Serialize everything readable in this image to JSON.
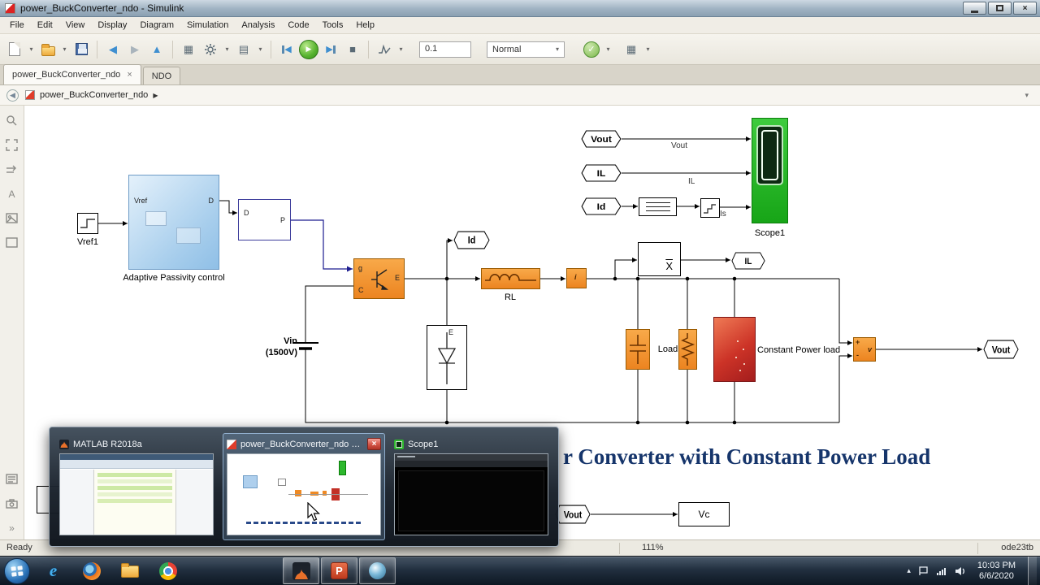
{
  "glyphs": {
    "caret_down": "▾",
    "crumb_arrow": "▶",
    "close": "×",
    "chevrons": "»",
    "tray_caret": "▴",
    "run_arrow": "▶",
    "back_arrow": "◀",
    "forward_arrow": "▶",
    "up_arrow": "▲",
    "stop_square": "■",
    "check": "✓",
    "grid": "▦",
    "list": "▤",
    "letter_a": "A",
    "ie_e": "e",
    "pp_p": "P"
  },
  "titlebar": {
    "title": "power_BuckConverter_ndo - Simulink"
  },
  "menubar": {
    "items": [
      "File",
      "Edit",
      "View",
      "Display",
      "Diagram",
      "Simulation",
      "Analysis",
      "Code",
      "Tools",
      "Help"
    ]
  },
  "toolbar": {
    "stop_time": "0.1",
    "mode": "Normal"
  },
  "tabbar": {
    "tabs": [
      {
        "label": "power_BuckConverter_ndo"
      },
      {
        "label": "NDO"
      }
    ]
  },
  "breadcrumb": {
    "path": "power_BuckConverter_ndo"
  },
  "canvas": {
    "annotation": "r Converter with Constant Power Load",
    "blocks": {
      "vref1": "Vref1",
      "apc_label": "Adaptive Passivity control",
      "apc_in": "Vref",
      "apc_out": "D",
      "ctrl_in": "D",
      "ctrl_out": "P",
      "igbt_g": "g",
      "igbt_c": "C",
      "igbt_e": "E",
      "rl": "RL",
      "isensor": "i",
      "mean": "X",
      "vin_name": "Vin",
      "vin_value": "(1500V)",
      "diode_e": "E",
      "load": "Load",
      "cpl": "Constant Power load",
      "vm_plus": "+",
      "vm_v": "v",
      "vm_minus": "-",
      "scope": "Scope1",
      "vc": "Vc"
    },
    "tags": {
      "from_vout": "Vout",
      "from_il": "IL",
      "from_id": "Id",
      "goto_id": "Id",
      "goto_il": "IL",
      "goto_vout": "Vout",
      "from_vout_bottom": "Vout"
    },
    "wire_labels": {
      "vout": "Vout",
      "il": "IL",
      "is": "Is"
    }
  },
  "statusbar": {
    "ready": "Ready",
    "zoom": "111%",
    "solver": "ode23tb"
  },
  "preview": {
    "windows": [
      {
        "title": "MATLAB R2018a"
      },
      {
        "title": "power_BuckConverter_ndo - ..."
      },
      {
        "title": "Scope1"
      }
    ]
  },
  "taskbar": {
    "clock": {
      "time": "10:03 PM",
      "date": "6/6/2020"
    }
  }
}
